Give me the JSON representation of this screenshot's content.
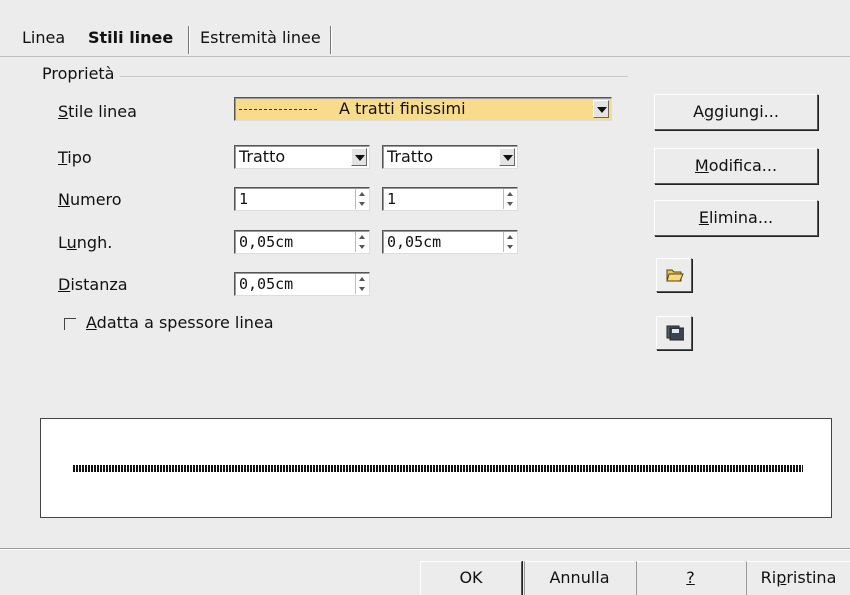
{
  "tabs": [
    {
      "label": "Linea"
    },
    {
      "label": "Stili linee"
    },
    {
      "label": "Estremità linee"
    }
  ],
  "group": {
    "label": "Proprietà"
  },
  "fields": {
    "stile_linea": {
      "label_first": "S",
      "label_rest": "tile linea",
      "value": "A tratti finissimi"
    },
    "tipo": {
      "label_first": "T",
      "label_rest": "ipo",
      "value1": "Tratto",
      "value2": "Tratto"
    },
    "numero": {
      "label_first": "N",
      "label_rest": "umero",
      "value1": "1",
      "value2": "1"
    },
    "lungh": {
      "label_pre": "L",
      "label_u": "u",
      "label_rest": "ngh.",
      "value1": "0,05cm",
      "value2": "0,05cm"
    },
    "distanza": {
      "label_first": "D",
      "label_rest": "istanza",
      "value": "0,05cm"
    }
  },
  "checkbox": {
    "label_first": "A",
    "label_rest": "datta a spessore linea",
    "checked": false
  },
  "side_buttons": {
    "aggiungi": {
      "pre": "A",
      "u": "g",
      "rest": "giungi..."
    },
    "modifica": {
      "pre": "",
      "u": "M",
      "rest": "odifica..."
    },
    "elimina": {
      "pre": "",
      "u": "E",
      "rest": "limina..."
    },
    "open_icon": "folder-open-icon",
    "save_icon": "save-icon"
  },
  "footer": {
    "ok": "OK",
    "annulla": "Annulla",
    "help": "?",
    "ripristina_pre": "Ri",
    "ripristina_u": "p",
    "ripristina_rest": "ristina"
  },
  "colors": {
    "highlight": "#f8dc8c",
    "background": "#ececec"
  }
}
